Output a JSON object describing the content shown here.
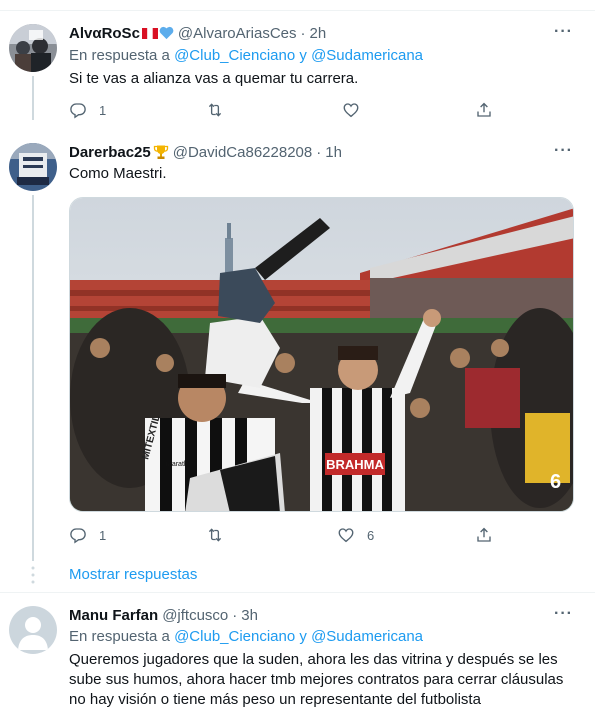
{
  "tweets": [
    {
      "name": "AlvαRoSc",
      "handle": "@AlvaroAriasCes",
      "dot": "·",
      "time": "2h",
      "reply_prefix": "En respuesta a ",
      "reply_user1": "@Club_Cienciano",
      "reply_and": " y ",
      "reply_user2": "@Sudamericana",
      "text": "Si te vas a alianza vas a quemar tu carrera.",
      "replies": "1",
      "retweets": "",
      "likes": ""
    },
    {
      "name": "Darerbac25",
      "handle": "@DavidCa86228208",
      "dot": "·",
      "time": "1h",
      "text": "Como Maestri.",
      "replies": "1",
      "retweets": "",
      "likes": "6",
      "media": {
        "jersey_text": "BRAHMA",
        "sponsor_left": "MITEXTIL",
        "sponsor_chest": "marathon",
        "player_number": "6"
      }
    },
    {
      "name": "Manu Farfan",
      "handle": "@jftcusco",
      "dot": "·",
      "time": "3h",
      "reply_prefix": "En respuesta a ",
      "reply_user1": "@Club_Cienciano",
      "reply_and": " y ",
      "reply_user2": "@Sudamericana",
      "text": "Queremos jugadores que la suden, ahora les das vitrina y después se les sube sus humos, ahora hacer tmb mejores contratos para cerrar cláusulas no hay visión o tiene más peso un representante del futbolista"
    }
  ],
  "show_replies": "Mostrar respuestas",
  "more_icon": "···",
  "colors": {
    "link": "#1d9bf0",
    "secondary": "#536471",
    "border": "#eff3f4",
    "thread_line": "#cfd9de"
  },
  "icons": [
    "reply-icon",
    "retweet-icon",
    "like-icon",
    "share-icon",
    "more-icon"
  ]
}
